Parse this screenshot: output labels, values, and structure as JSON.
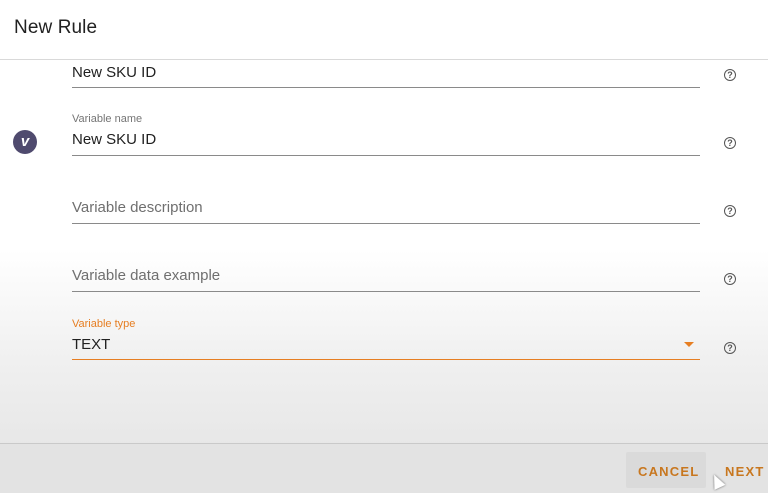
{
  "dialog": {
    "title": "New Rule"
  },
  "fields": {
    "sku_id": {
      "value": "New SKU ID"
    },
    "variable_name": {
      "label": "Variable name",
      "value": "New SKU ID"
    },
    "variable_description": {
      "placeholder": "Variable description"
    },
    "variable_data_example": {
      "placeholder": "Variable data example"
    },
    "variable_type": {
      "label": "Variable type",
      "value": "TEXT"
    }
  },
  "help_glyph": "?",
  "avatar_letter": "v",
  "actions": {
    "cancel_label": "CANCEL",
    "next_label": "NEXT"
  },
  "colors": {
    "accent": "#e67e22",
    "avatar_bg": "#4f4a6e"
  },
  "icons": {
    "help": "help-circle-icon",
    "dropdown": "dropdown-arrow-icon",
    "avatar": "vimeo-logo-icon"
  }
}
